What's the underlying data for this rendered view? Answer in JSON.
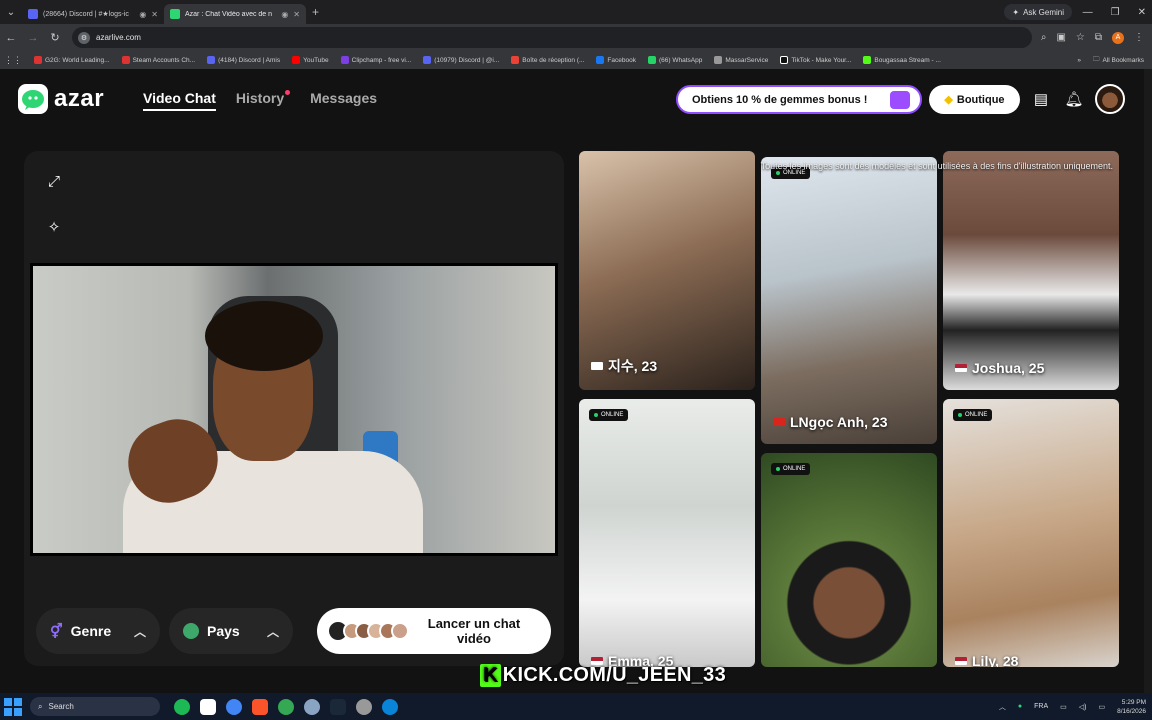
{
  "browser": {
    "tabs": [
      {
        "title": "(28664) Discord | #★logs-ic",
        "active": false
      },
      {
        "title": "Azar : Chat Vidéo avec de n",
        "active": true
      }
    ],
    "new_tab": "+",
    "ask_gemini": "Ask Gemini",
    "url": "azarlive.com",
    "profile_letter": "A",
    "bookmarks": [
      {
        "label": "G2G: World Leading...",
        "color": "#d33"
      },
      {
        "label": "Steam Accounts Ch...",
        "color": "#d33"
      },
      {
        "label": "(4184) Discord | Amis",
        "color": "#5865f2"
      },
      {
        "label": "YouTube",
        "color": "#f00"
      },
      {
        "label": "Clipchamp - free vi...",
        "color": "#7b3fe4"
      },
      {
        "label": "(10979) Discord | @i...",
        "color": "#5865f2"
      },
      {
        "label": "Boîte de réception (...",
        "color": "#ea4335"
      },
      {
        "label": "Facebook",
        "color": "#1877f2"
      },
      {
        "label": "(66) WhatsApp",
        "color": "#25d366"
      },
      {
        "label": "MassarService",
        "color": "#999"
      },
      {
        "label": "TikTok - Make Your...",
        "color": "#111"
      },
      {
        "label": "Bougassaa Stream - ...",
        "color": "#53fc18"
      }
    ],
    "all_bookmarks": "All Bookmarks"
  },
  "header": {
    "logo": "azar",
    "nav": [
      {
        "label": "Video Chat",
        "active": true
      },
      {
        "label": "History",
        "active": false,
        "dot": true
      },
      {
        "label": "Messages",
        "active": false
      }
    ],
    "promo": "Obtiens 10 % de gemmes bonus !",
    "boutique": "Boutique"
  },
  "controls": {
    "genre": "Genre",
    "pays": "Pays",
    "start_label": "Lancer un chat vidéo"
  },
  "gallery": {
    "disclaimer": "Toutes les images sont des modèles et sont utilisées à des fins d'illustration uniquement.",
    "online_label": "ONLINE",
    "cards": [
      {
        "name": "지수, 23",
        "online": false
      },
      {
        "name": "LNgọc Anh, 23",
        "online": true
      },
      {
        "name": "Joshua, 25",
        "online": false
      },
      {
        "name": "Emma, 25",
        "online": true
      },
      {
        "name": "",
        "online": true
      },
      {
        "name": "Lily, 28",
        "online": true
      }
    ]
  },
  "overlay": {
    "k": "K",
    "text": "KICK.COM/U_JEEN_33"
  },
  "taskbar": {
    "search": "Search",
    "lang": "FRA",
    "time": "5:29 PM",
    "date": "8/16/2026"
  },
  "colors": {
    "accent": "#8f4dff",
    "brand_green": "#2ed573",
    "online": "#27d36a",
    "kick": "#53fc18"
  }
}
